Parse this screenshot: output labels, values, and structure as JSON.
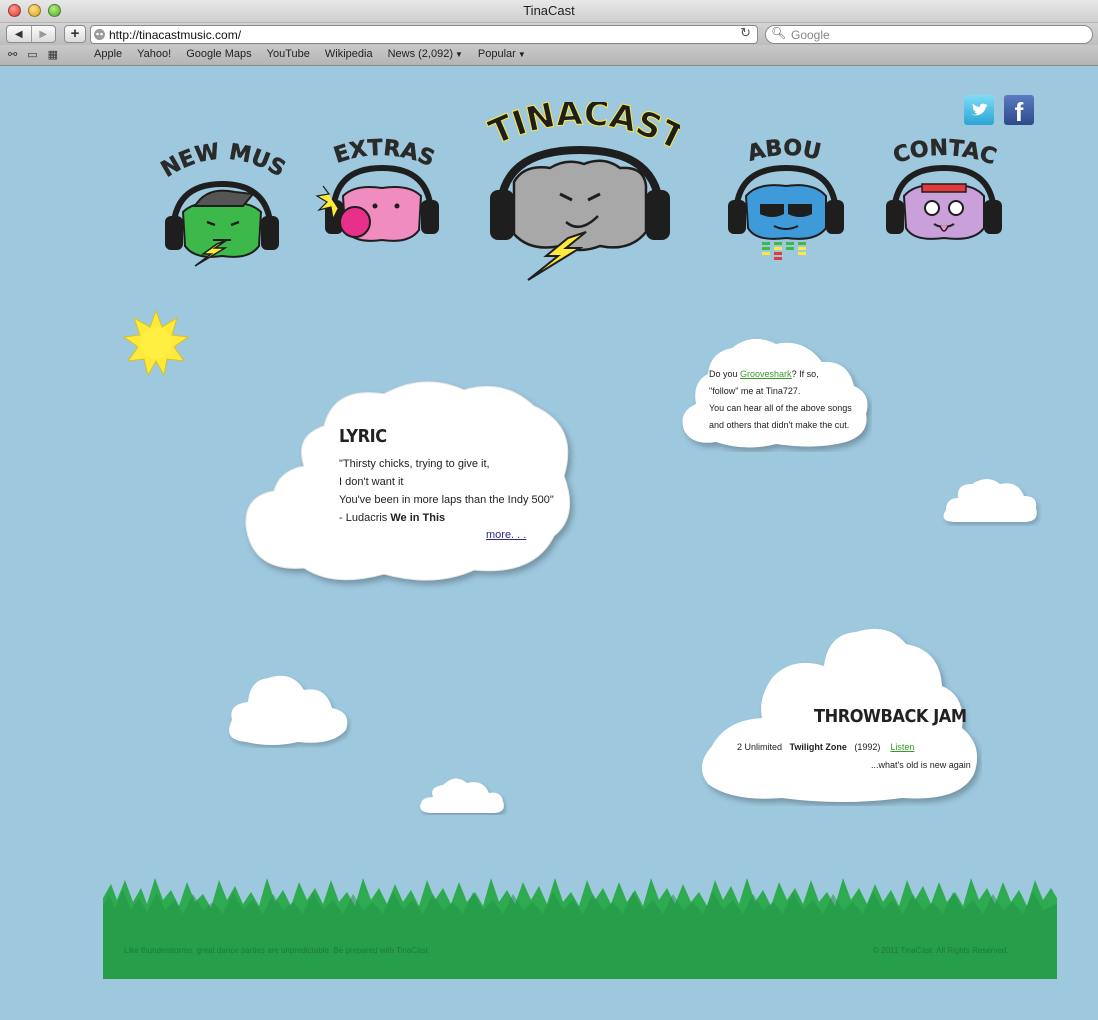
{
  "browser": {
    "window_title": "TinaCast",
    "url": "http://tinacastmusic.com/",
    "search_placeholder": "Google",
    "bookmarks": [
      "Apple",
      "Yahoo!",
      "Google Maps",
      "YouTube",
      "Wikipedia",
      "News (2,092)",
      "Popular"
    ]
  },
  "site": {
    "logo": "TINACAST",
    "nav": [
      "NEW MUSIC",
      "EXTRAS",
      "ABOUT",
      "CONTACT"
    ],
    "lyric": {
      "heading": "LYRIC",
      "lines": [
        "\"Thirsty chicks, trying to give it,",
        "I don't want it",
        "You've been in more laps than the Indy 500\""
      ],
      "credit_prefix": "- Ludacris ",
      "credit_song": "We in This",
      "more": "more. . ."
    },
    "grooveshark": {
      "line1_pre": "Do you ",
      "line1_link": "Grooveshark",
      "line1_post": "? If so,",
      "line2": "\"follow\" me at Tina727.",
      "line3": "You can hear all of the above songs",
      "line4": "and others that didn't make the cut."
    },
    "throwback": {
      "heading": "THROWBACK JAM",
      "artist": "2 Unlimited",
      "song": "Twilight Zone",
      "year": "(1992)",
      "listen": "Listen",
      "tagline": "...what's old is new again"
    },
    "footer": {
      "left": "Like thunderstorms, great dance parties are unpredictable. Be prepared with TinaCast.",
      "right": "© 2011 TinaCast. All Rights Reserved."
    }
  },
  "colors": {
    "sky": "#9ec8de",
    "grass": "#2eaa50",
    "cloud": "#ffffff",
    "green_face": "#3cb94a",
    "pink_face": "#f08cc0",
    "gray_face": "#a8a8a8",
    "blue_face": "#3e9ad8",
    "purple_face": "#c9a0d9",
    "bolt": "#ffe93b"
  }
}
